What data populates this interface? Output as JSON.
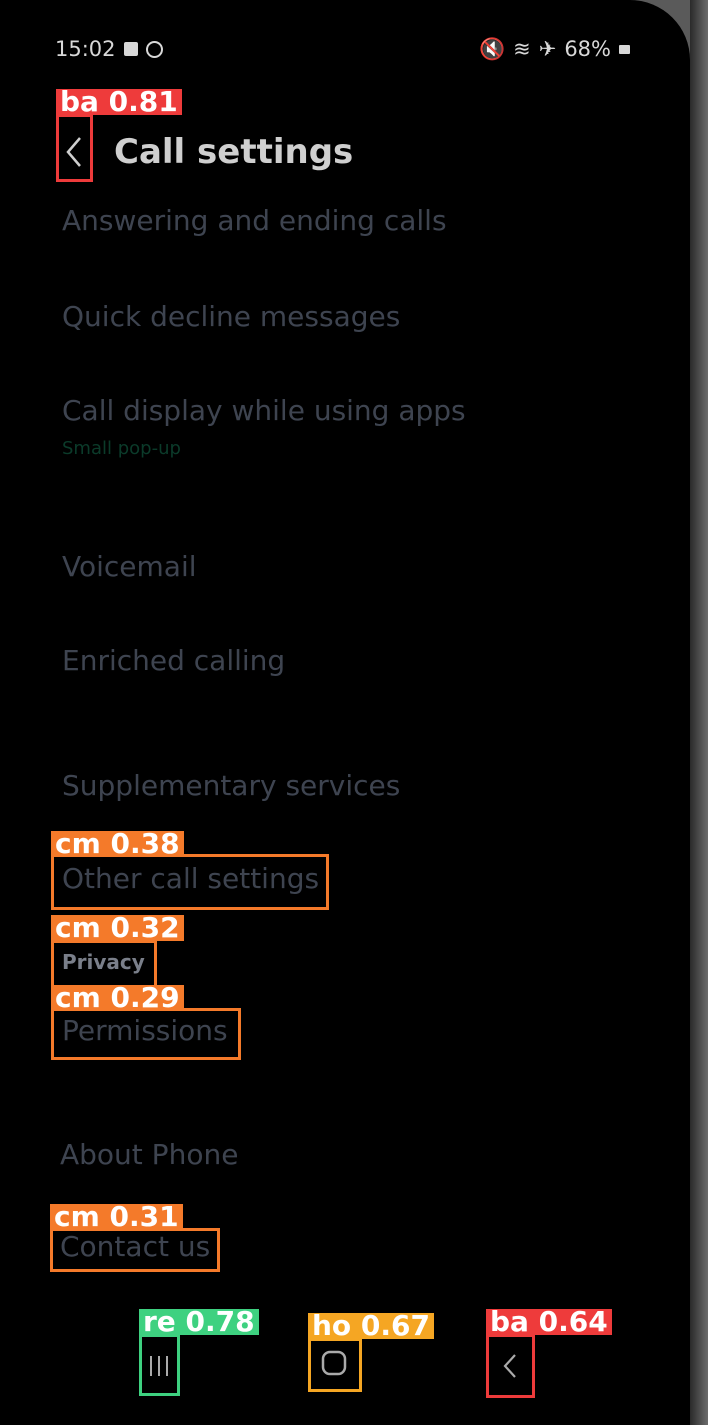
{
  "status_bar": {
    "time": "15:02",
    "battery": "68%",
    "icons": [
      "mute-icon",
      "wifi-icon",
      "airplane-icon",
      "battery-icon"
    ]
  },
  "header": {
    "title": "Call settings"
  },
  "menu": {
    "answering": "Answering and ending calls",
    "quick_decline": "Quick decline messages",
    "call_display": "Call display while using apps",
    "call_display_sub": "Small pop-up",
    "voicemail": "Voicemail",
    "enriched": "Enriched calling",
    "supplementary": "Supplementary services",
    "other": "Other call settings",
    "privacy": "Privacy",
    "permissions": "Permissions",
    "about": "About Phone",
    "contact": "Contact us"
  },
  "detections": {
    "back_top": "ba 0.81",
    "other": "cm 0.38",
    "privacy": "cm 0.32",
    "permissions": "cm 0.29",
    "contact": "cm 0.31",
    "recents": "re 0.78",
    "home": "ho 0.67",
    "back_nav": "ba 0.64"
  },
  "colors": {
    "ba": "#ee3b3b",
    "cm": "#f47a2a",
    "re": "#3ed180",
    "ho": "#f5a623"
  }
}
